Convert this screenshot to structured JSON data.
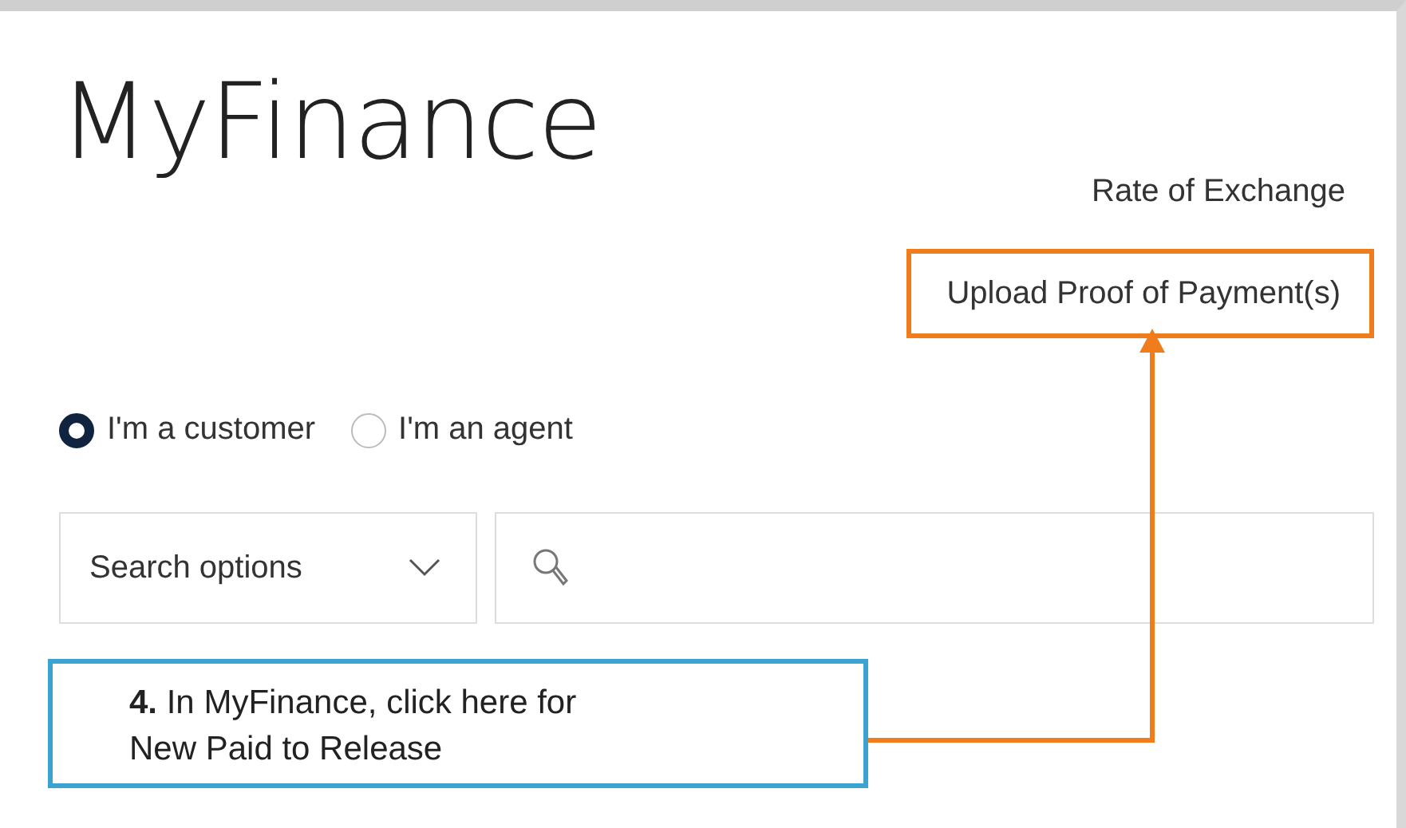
{
  "title": "MyFinance",
  "links": [
    {
      "label": "Rate of Exchange",
      "highlighted": false
    },
    {
      "label": "Upload Proof of Payment(s)",
      "highlighted": true
    }
  ],
  "roles": [
    {
      "label": "I'm a customer",
      "selected": true
    },
    {
      "label": "I'm an agent",
      "selected": false
    }
  ],
  "search": {
    "dropdown": "Search options"
  },
  "callout": {
    "lines": [
      "**4.** In MyFinance, click here for",
      "New Paid to Release"
    ]
  }
}
